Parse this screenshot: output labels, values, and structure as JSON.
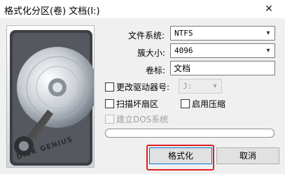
{
  "window": {
    "title": "格式化分区(卷) 文档(I:)",
    "close_glyph": "✕"
  },
  "image_panel": {
    "brand": "DISK GENIUS"
  },
  "form": {
    "filesystem_label": "文件系统:",
    "filesystem_value": "NTFS",
    "cluster_label": "簇大小:",
    "cluster_value": "4096",
    "volume_label": "卷标:",
    "volume_value": "文档",
    "change_drive_label": "更改驱动器号:",
    "drive_letter_value": "J:",
    "scan_bad_label": "扫描坏扇区",
    "enable_compress_label": "启用压缩",
    "create_dos_label": "建立DOS系统"
  },
  "progress": {
    "value": 0
  },
  "buttons": {
    "format_label": "格式化",
    "cancel_label": "取消"
  },
  "colors": {
    "highlight": "#e02020",
    "default_button_border": "#0078d7"
  }
}
